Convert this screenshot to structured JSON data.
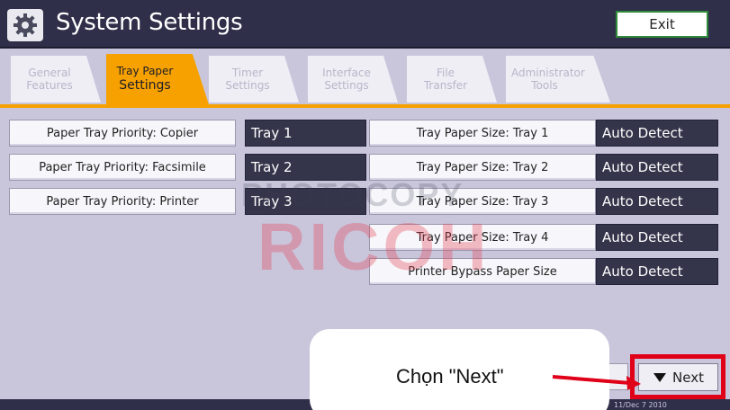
{
  "header": {
    "title": "System Settings",
    "icon": "gear-icon",
    "exit_label": "Exit"
  },
  "tabs": [
    {
      "line1": "General",
      "line2": "Features",
      "active": false
    },
    {
      "line1": "Tray Paper",
      "line2": "Settings",
      "active": true
    },
    {
      "line1": "Timer",
      "line2": "Settings",
      "active": false
    },
    {
      "line1": "Interface",
      "line2": "Settings",
      "active": false
    },
    {
      "line1": "File",
      "line2": "Transfer",
      "active": false
    },
    {
      "line1": "Administrator",
      "line2": "Tools",
      "active": false
    }
  ],
  "left_settings": [
    {
      "label": "Paper Tray Priority: Copier",
      "value": "Tray 1"
    },
    {
      "label": "Paper Tray Priority: Facsimile",
      "value": "Tray 2"
    },
    {
      "label": "Paper Tray Priority: Printer",
      "value": "Tray 3"
    }
  ],
  "right_settings": [
    {
      "label": "Tray Paper Size: Tray 1",
      "value": "Auto Detect"
    },
    {
      "label": "Tray Paper Size: Tray 2",
      "value": "Auto Detect"
    },
    {
      "label": "Tray Paper Size: Tray 3",
      "value": "Auto Detect"
    },
    {
      "label": "Tray Paper Size: Tray 4",
      "value": "Auto Detect"
    },
    {
      "label": "Printer Bypass Paper Size",
      "value": "Auto Detect"
    }
  ],
  "watermark": {
    "line1": "PHOTOCOPY",
    "line2": "RICOH"
  },
  "navigation": {
    "next_label": "Next",
    "next_icon": "triangle-down-icon"
  },
  "callout": {
    "text": "Chọn \"Next\""
  },
  "footer": {
    "stamp": "11/Dec 7 2010"
  },
  "colors": {
    "header_bg": "#2f2f4a",
    "panel_bg": "#c9c6dc",
    "active_tab": "#f6a100",
    "value_bg": "#34344a",
    "highlight_red": "#e00018",
    "watermark_red": "#e1465a"
  }
}
